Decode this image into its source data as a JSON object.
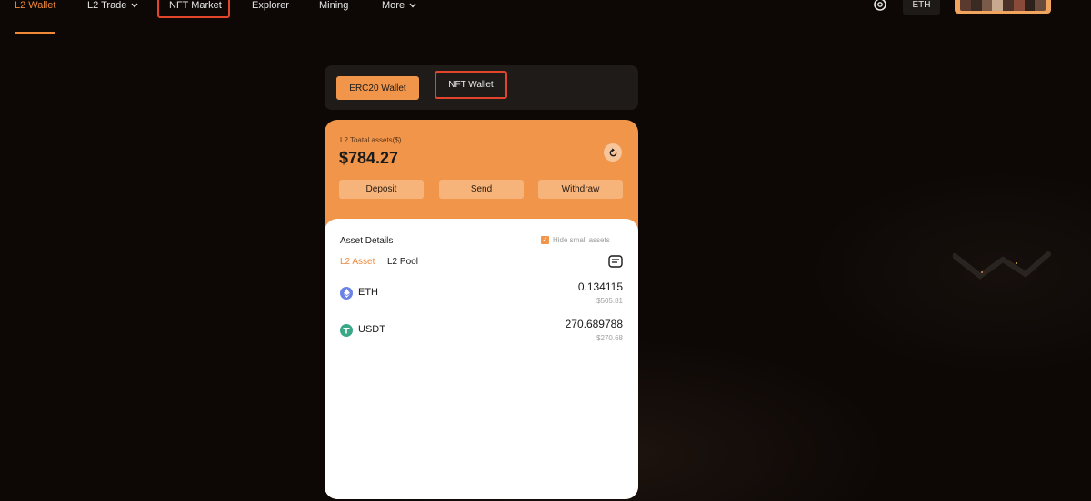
{
  "nav": {
    "items": [
      {
        "label": "L2 Wallet",
        "active": true,
        "dropdown": false
      },
      {
        "label": "L2 Trade",
        "active": false,
        "dropdown": true
      },
      {
        "label": "NFT Market",
        "active": false,
        "dropdown": false
      },
      {
        "label": "Explorer",
        "active": false,
        "dropdown": false
      },
      {
        "label": "Mining",
        "active": false,
        "dropdown": false
      },
      {
        "label": "More",
        "active": false,
        "dropdown": true
      }
    ],
    "settings_icon": "gear-icon",
    "network": "ETH"
  },
  "wallet_tabs": {
    "erc20": "ERC20 Wallet",
    "nft": "NFT Wallet"
  },
  "balance": {
    "label": "L2 Toatal assets($)",
    "value": "$784.27",
    "refresh_icon": "refresh-icon"
  },
  "actions": {
    "deposit": "Deposit",
    "send": "Send",
    "withdraw": "Withdraw"
  },
  "details": {
    "title": "Asset Details",
    "hide_small": "Hide small assets",
    "hide_small_checked": true,
    "tabs": {
      "l2_asset": "L2 Asset",
      "l2_pool": "L2 Pool"
    },
    "list_icon": "list-icon"
  },
  "assets": [
    {
      "symbol": "ETH",
      "amount": "0.134115",
      "usd": "$505.81",
      "icon": "eth-icon"
    },
    {
      "symbol": "USDT",
      "amount": "270.689788",
      "usd": "$270.68",
      "icon": "usdt-icon"
    }
  ],
  "colors": {
    "accent": "#f0883a",
    "card": "#f0954a",
    "highlight": "#e2452b",
    "background": "#0d0806"
  }
}
